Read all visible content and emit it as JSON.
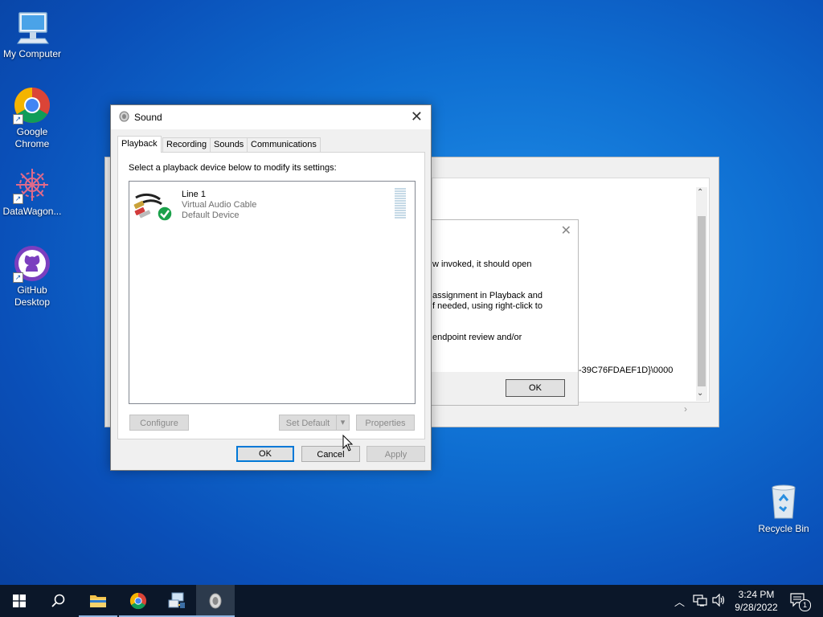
{
  "desktop": {
    "icons": [
      {
        "label_line1": "My Computer",
        "label_line2": ""
      },
      {
        "label_line1": "Google",
        "label_line2": "Chrome"
      },
      {
        "label_line1": "DataWagon...",
        "label_line2": ""
      },
      {
        "label_line1": "GitHub",
        "label_line2": "Desktop"
      },
      {
        "label_line1": "Recycle Bin",
        "label_line2": ""
      }
    ]
  },
  "background_window": {
    "message_lines": [
      "w invoked, it should open",
      "assignment in Playback and",
      "f needed, using right-click to",
      "endpoint review and/or"
    ],
    "device_id_fragment": "-39C76FDAEF1D}\\0000",
    "ok_label": "OK"
  },
  "sound_dialog": {
    "title": "Sound",
    "tabs": [
      {
        "label": "Playback",
        "active": true
      },
      {
        "label": "Recording",
        "active": false
      },
      {
        "label": "Sounds",
        "active": false
      },
      {
        "label": "Communications",
        "active": false
      }
    ],
    "instruction": "Select a playback device below to modify its settings:",
    "device": {
      "name": "Line 1",
      "description": "Virtual Audio Cable",
      "status": "Default Device"
    },
    "buttons": {
      "configure": "Configure",
      "set_default": "Set Default",
      "properties": "Properties",
      "ok": "OK",
      "cancel": "Cancel",
      "apply": "Apply"
    }
  },
  "taskbar": {
    "time": "3:24 PM",
    "date": "9/28/2022",
    "notification_count": "1"
  },
  "colors": {
    "accent": "#0078d7",
    "taskbar": "#0b1729",
    "desktop": "#0f6fd2"
  }
}
